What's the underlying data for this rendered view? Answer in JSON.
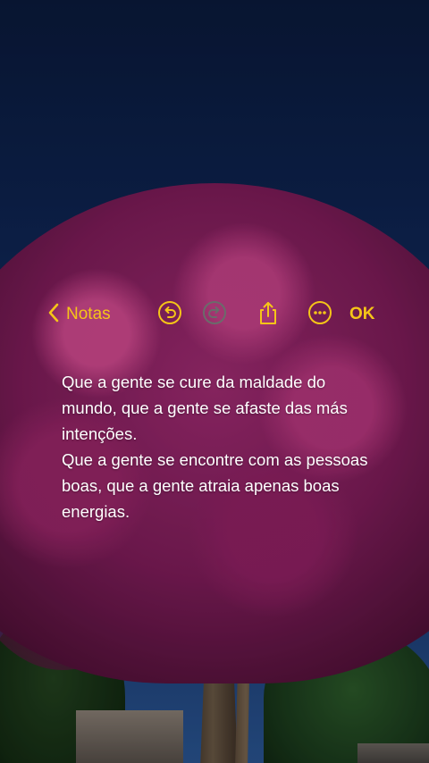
{
  "toolbar": {
    "back_label": "Notas",
    "done_label": "OK",
    "icons": {
      "back": "chevron-left-icon",
      "undo": "undo-icon",
      "redo": "redo-icon",
      "share": "share-icon",
      "more": "more-icon"
    },
    "accent_color": "#f5c518",
    "redo_disabled_color": "#6b6b6b"
  },
  "note": {
    "paragraph_1": "Que a gente se cure da maldade do mundo, que a gente se afaste das más intenções.",
    "paragraph_2": "Que a gente se encontre com as pessoas boas, que a gente atraia apenas boas energias."
  }
}
